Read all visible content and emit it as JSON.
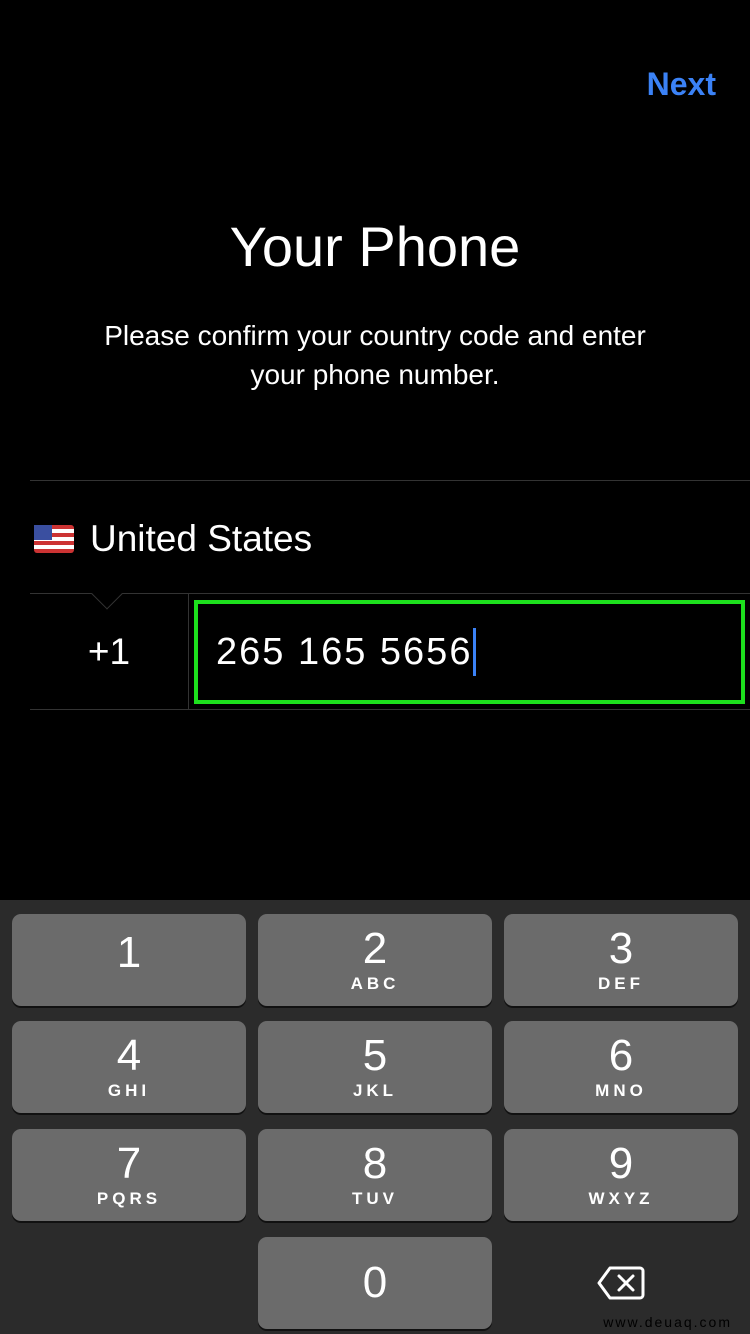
{
  "nav": {
    "next_label": "Next"
  },
  "header": {
    "title": "Your Phone",
    "subtitle": "Please confirm your country code and enter your phone number."
  },
  "country": {
    "name": "United States",
    "flag_icon": "us-flag-icon"
  },
  "phone": {
    "country_code": "+1",
    "number": "265 165 5656"
  },
  "colors": {
    "accent": "#3b82f6",
    "highlight_border": "#1de01d",
    "key": "#6b6b6b",
    "keyboard": "#2b2b2b"
  },
  "keypad": {
    "keys": [
      {
        "digit": "1",
        "letters": ""
      },
      {
        "digit": "2",
        "letters": "ABC"
      },
      {
        "digit": "3",
        "letters": "DEF"
      },
      {
        "digit": "4",
        "letters": "GHI"
      },
      {
        "digit": "5",
        "letters": "JKL"
      },
      {
        "digit": "6",
        "letters": "MNO"
      },
      {
        "digit": "7",
        "letters": "PQRS"
      },
      {
        "digit": "8",
        "letters": "TUV"
      },
      {
        "digit": "9",
        "letters": "WXYZ"
      },
      {
        "digit": "0",
        "letters": ""
      }
    ],
    "delete_icon": "backspace-icon"
  },
  "watermark": "www.deuaq.com"
}
